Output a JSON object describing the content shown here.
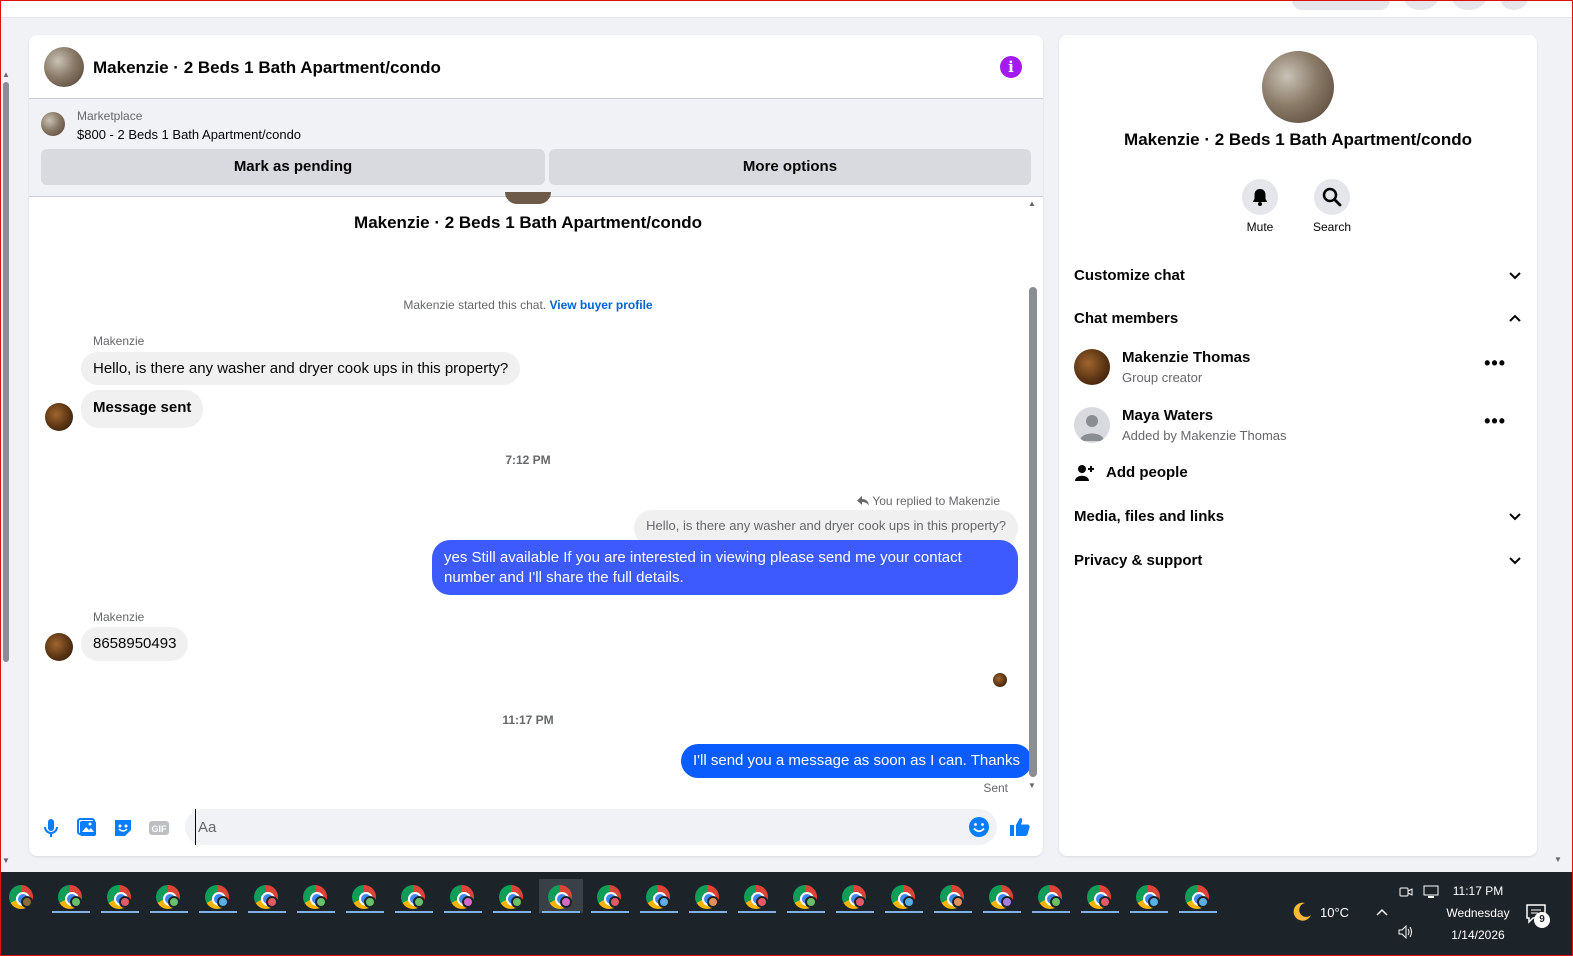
{
  "chat": {
    "title": "Makenzie · 2 Beds 1 Bath Apartment/condo",
    "marketplace_label": "Marketplace",
    "listing": "$800 - 2 Beds 1 Bath Apartment/condo",
    "mark_pending_label": "Mark as pending",
    "more_options_label": "More options",
    "started_text": "Makenzie started this chat.",
    "view_buyer_profile": "View buyer profile"
  },
  "messages": {
    "sender1": "Makenzie",
    "msg1": "Hello, is there any washer and dryer cook ups in this property?",
    "msg2": "Message sent",
    "time1": "7:12 PM",
    "replied_label": "You replied to Makenzie",
    "quoted": "Hello, is there any washer and dryer cook ups in this property?",
    "reply": "yes Still available If you are interested in viewing please send me your contact number and I'll share the full details.",
    "sender2": "Makenzie",
    "msg3": "8658950493",
    "time2": "11:17 PM",
    "msg4": "I'll send you a message as soon as I can. Thanks",
    "sent_status": "Sent"
  },
  "composer": {
    "placeholder": "Aa"
  },
  "sidebar": {
    "title": "Makenzie · 2 Beds 1 Bath Apartment/condo",
    "mute_label": "Mute",
    "search_label": "Search",
    "customize_chat": "Customize chat",
    "chat_members": "Chat members",
    "members": [
      {
        "name": "Makenzie Thomas",
        "role": "Group creator"
      },
      {
        "name": "Maya Waters",
        "role": "Added by Makenzie Thomas"
      }
    ],
    "add_people": "Add people",
    "media_files_links": "Media, files and links",
    "privacy_support": "Privacy & support"
  },
  "taskbar": {
    "weather_temp": "10°C",
    "time": "11:17 PM",
    "day": "Wednesday",
    "date": "1/14/2026",
    "notification_count": "9",
    "app_count": 25
  },
  "colors": {
    "accent_blue": "#0a7cff",
    "outgoing_bubble": "#3d5afe",
    "info_purple": "#a31bf0"
  }
}
